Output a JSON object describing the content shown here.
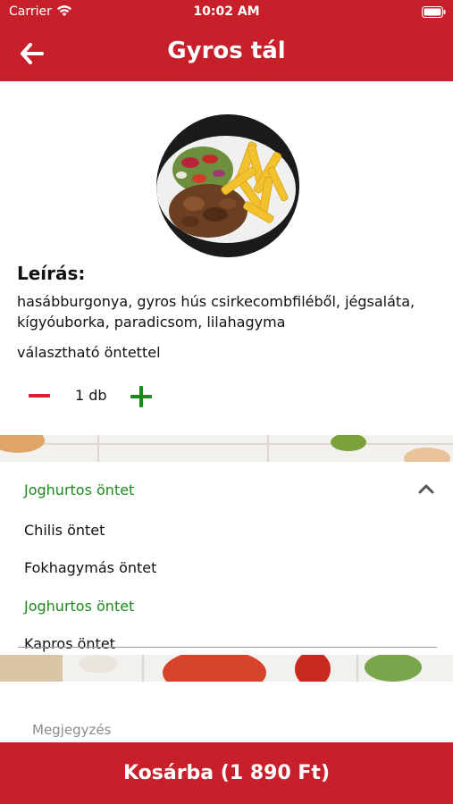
{
  "status_bar": {
    "carrier": "Carrier",
    "time": "10:02 AM"
  },
  "header": {
    "title": "Gyros tál",
    "back_icon": "arrow-left-icon"
  },
  "product": {
    "image": "gyros-plate-photo",
    "description_heading": "Leírás:",
    "description": "hasábburgonya, gyros hús csirkecombfiléből, jégsaláta, kígyóuborka, paradicsom, lilahagyma",
    "sauce_note": "választható öntettel"
  },
  "quantity": {
    "value": "1 db",
    "minus_icon": "minus-icon",
    "plus_icon": "plus-icon"
  },
  "sauce_dropdown": {
    "selected": "Joghurtos öntet",
    "options": [
      "Chilis öntet",
      "Fokhagymás öntet",
      "Joghurtos öntet",
      "Kapros öntet"
    ],
    "active_option": "Joghurtos öntet"
  },
  "note": {
    "placeholder": "Megjegyzés",
    "value": ""
  },
  "cart_button": {
    "label": "Kosárba (1 890 Ft)"
  },
  "colors": {
    "brand_red": "#c8202a",
    "accent_green": "#1d8a1d",
    "minus_red": "#d8202a"
  }
}
